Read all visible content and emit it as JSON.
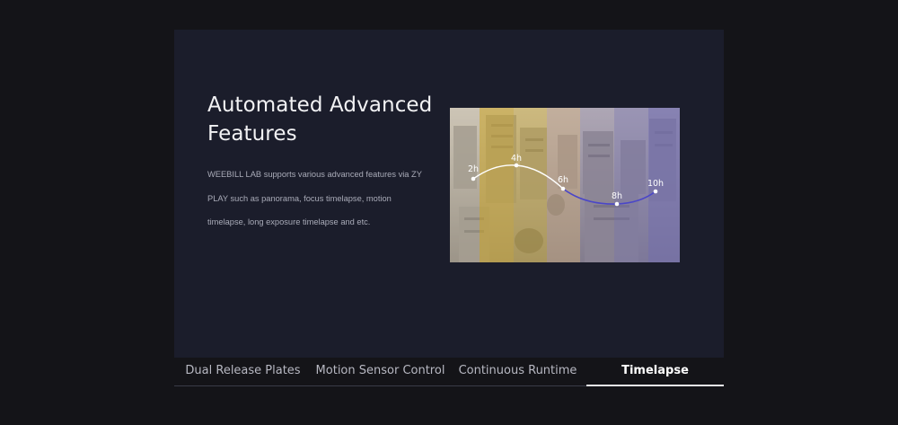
{
  "feature": {
    "title": "Automated Advanced Features",
    "description": "WEEBILL LAB supports various advanced features via ZY PLAY such as panorama, focus timelapse, motion timelapse, long exposure timelapse and etc."
  },
  "timelapse_graphic": {
    "markers": [
      {
        "label": "2h"
      },
      {
        "label": "4h"
      },
      {
        "label": "6h"
      },
      {
        "label": "8h"
      },
      {
        "label": "10h"
      }
    ],
    "colors": {
      "warm_band": "#c9a83a",
      "mid_band": "#b89a86",
      "cool_band": "#6f6bb0",
      "curve_day": "#ffffff",
      "curve_night": "#4a46c8"
    }
  },
  "tabs": [
    {
      "label": "Dual Release Plates",
      "active": false
    },
    {
      "label": "Motion Sensor Control",
      "active": false
    },
    {
      "label": "Continuous Runtime",
      "active": false
    },
    {
      "label": "Timelapse",
      "active": true
    }
  ]
}
